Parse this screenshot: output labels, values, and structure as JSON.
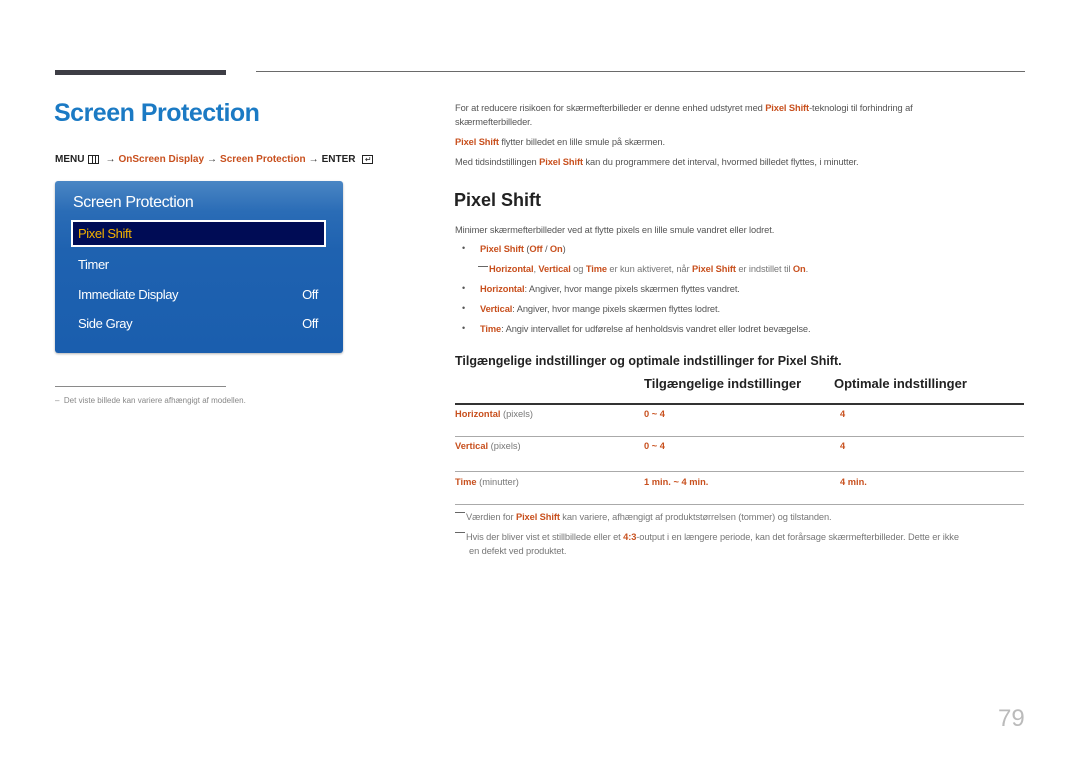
{
  "header": {
    "title": "Screen Protection",
    "menu_path": {
      "menu_label": "MENU",
      "menu_icon": "menu-grid-icon",
      "arrow": "→",
      "step1": "OnScreen Display",
      "step2": "Screen Protection",
      "enter_label": "ENTER",
      "enter_icon": "enter-icon"
    }
  },
  "osd": {
    "title": "Screen Protection",
    "items": [
      {
        "label": "Pixel Shift",
        "value": "",
        "selected": true
      },
      {
        "label": "Timer",
        "value": ""
      },
      {
        "label": "Immediate Display",
        "value": "Off"
      },
      {
        "label": "Side Gray",
        "value": "Off"
      }
    ]
  },
  "left_footnote": {
    "dash": "–",
    "text": "Det viste billede kan variere afhængigt af modellen."
  },
  "intro": {
    "p1_a": "For at reducere risikoen for skærmefterbilleder er denne enhed udstyret med ",
    "p1_hl": "Pixel Shift",
    "p1_b": "-teknologi til forhindring af",
    "p1_c": "skærmefterbilleder.",
    "p2_hl": "Pixel Shift",
    "p2_b": " flytter billedet en lille smule på skærmen.",
    "p3_a": "Med tidsindstillingen ",
    "p3_hl": "Pixel Shift",
    "p3_b": " kan du programmere det interval, hvormed billedet flyttes, i minutter."
  },
  "section": {
    "title": "Pixel Shift",
    "desc": "Minimer skærmefterbilleder ved at flytte pixels en lille smule vandret eller lodret.",
    "bullet_dot": "•",
    "option": {
      "label": "Pixel Shift",
      "open": " (",
      "off": "Off",
      "sep": " / ",
      "on": "On",
      "close": ")"
    },
    "note": {
      "h": "Horizontal",
      "comma": ", ",
      "v": "Vertical",
      "og": " og ",
      "t": "Time",
      "mid": " er kun aktiveret, når ",
      "ps": "Pixel Shift",
      "end": " er indstillet til ",
      "on": "On",
      "dot": "."
    },
    "bullets": [
      {
        "term": "Horizontal",
        "text": ": Angiver, hvor mange pixels skærmen flyttes vandret."
      },
      {
        "term": "Vertical",
        "text": ": Angiver, hvor mange pixels skærmen flyttes lodret."
      },
      {
        "term": "Time",
        "text": ": Angiv intervallet for udførelse af henholdsvis vandret eller lodret bevægelse."
      }
    ]
  },
  "table": {
    "heading": "Tilgængelige indstillinger og optimale indstillinger for Pixel Shift.",
    "columns": [
      "Tilgængelige indstillinger",
      "Optimale indstillinger"
    ],
    "rows": [
      {
        "name": "Horizontal",
        "unit": " (pixels)",
        "available": "0 ~ 4",
        "optimal": "4"
      },
      {
        "name": "Vertical",
        "unit": " (pixels)",
        "available": "0 ~ 4",
        "optimal": "4"
      },
      {
        "name": "Time",
        "unit": " (minutter)",
        "available": "1 min. ~ 4 min.",
        "optimal": "4 min."
      }
    ]
  },
  "notes": {
    "n1_a": "Værdien for ",
    "n1_hl": "Pixel Shift",
    "n1_b": " kan variere, afhængigt af produktstørrelsen (tommer) og tilstanden.",
    "n2_a": "Hvis der bliver vist et stillbillede eller et ",
    "n2_hl": "4:3",
    "n2_b": "-output i en længere periode, kan det forårsage skærmefterbilleder. Dette er ikke",
    "n2_c": "en defekt ved produktet."
  },
  "page_number": "79",
  "colors": {
    "title_blue": "#1b7ac4",
    "accent_orange": "#c8501e",
    "osd_blue": "#1f62b0",
    "osd_selected_bg": "#000c55",
    "osd_selected_text": "#f2b100"
  }
}
